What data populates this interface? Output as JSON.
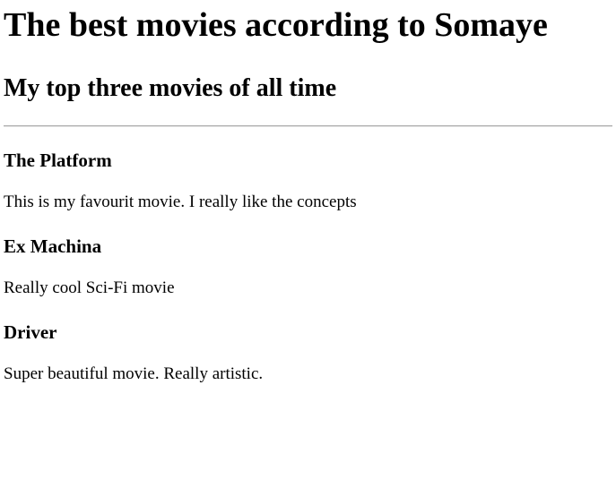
{
  "page": {
    "title": "The best movies according to Somaye",
    "subtitle": "My top three movies of all time"
  },
  "movies": [
    {
      "title": "The Platform",
      "description": "This is my favourit movie. I really like the concepts"
    },
    {
      "title": "Ex Machina",
      "description": "Really cool Sci-Fi movie"
    },
    {
      "title": "Driver",
      "description": "Super beautiful movie. Really artistic."
    }
  ]
}
